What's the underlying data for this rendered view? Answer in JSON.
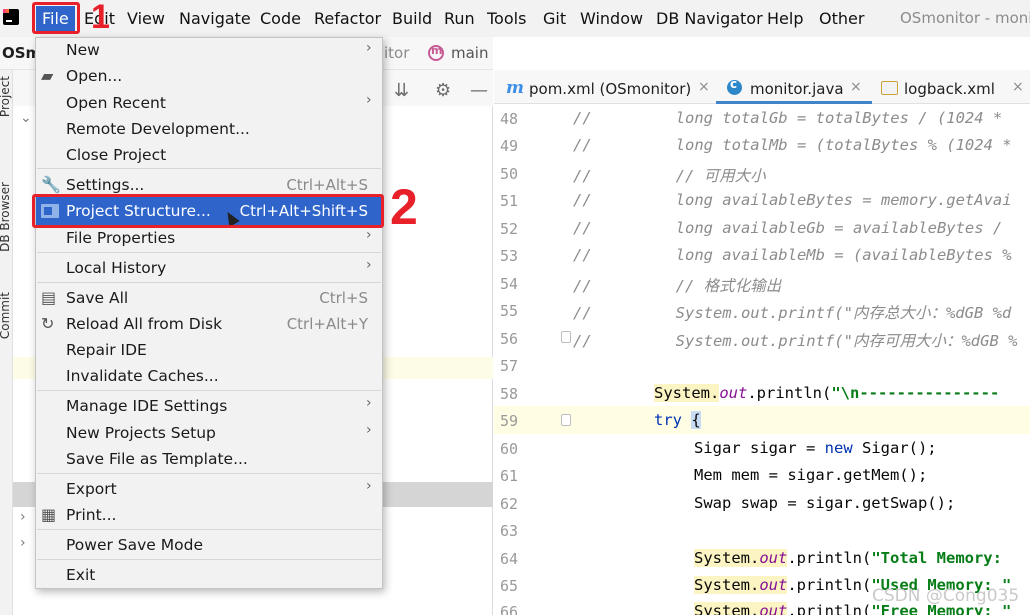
{
  "menubar": {
    "items": [
      "File",
      "Edit",
      "View",
      "Navigate",
      "Code",
      "Refactor",
      "Build",
      "Run",
      "Tools",
      "Git",
      "Window",
      "DB Navigator",
      "Help",
      "Other"
    ],
    "window_title": "OSmonitor - moni"
  },
  "annotations": {
    "step1": "1",
    "step2": "2",
    "color": "#e8202a"
  },
  "navbar": {
    "project_name": "OSm",
    "crumb_rest": "itor",
    "branch": "main"
  },
  "tool_strip": {
    "tabs": [
      "Project",
      "DB Browser",
      "Commit"
    ]
  },
  "editor_tabs": [
    {
      "label": "pom.xml (OSmonitor)",
      "icon": "maven-icon",
      "close": "×"
    },
    {
      "label": "monitor.java",
      "icon": "java-class-icon",
      "close": "×",
      "active": true
    },
    {
      "label": "logback.xml",
      "icon": "xml-file-icon",
      "close": "×"
    }
  ],
  "file_menu": {
    "items": {
      "new": "New",
      "open": "Open...",
      "open_recent": "Open Recent",
      "remote_dev": "Remote Development...",
      "close_project": "Close Project",
      "settings": "Settings...",
      "settings_sc": "Ctrl+Alt+S",
      "project_structure": "Project Structure...",
      "project_structure_sc": "Ctrl+Alt+Shift+S",
      "file_properties": "File Properties",
      "local_history": "Local History",
      "save_all": "Save All",
      "save_all_sc": "Ctrl+S",
      "reload": "Reload All from Disk",
      "reload_sc": "Ctrl+Alt+Y",
      "repair": "Repair IDE",
      "invalidate": "Invalidate Caches...",
      "manage_settings": "Manage IDE Settings",
      "new_projects_setup": "New Projects Setup",
      "save_template": "Save File as Template...",
      "export": "Export",
      "print": "Print...",
      "power_save": "Power Save Mode",
      "exit": "Exit"
    }
  },
  "code": {
    "line_numbers": [
      "48",
      "49",
      "50",
      "51",
      "52",
      "53",
      "54",
      "55",
      "56",
      "57",
      "58",
      "59",
      "60",
      "61",
      "62",
      "63",
      "64",
      "65",
      "66"
    ],
    "l48": "//         long totalGb = totalBytes / (1024 *",
    "l49": "//         long totalMb = (totalBytes % (1024 *",
    "l50": "//         // 可用大小",
    "l51": "//         long availableBytes = memory.getAvai",
    "l52": "//         long availableGb = availableBytes /",
    "l53": "//         long availableMb = (availableBytes %",
    "l54": "//         // 格式化输出",
    "l55": "//         System.out.printf(\"内存总大小：%dGB %d",
    "l56": "//         System.out.printf(\"内存可用大小：%dGB %",
    "l58_a": "System.",
    "l58_b": "out",
    "l58_c": ".println(",
    "l58_d": "\"\\n---------------",
    "l59_a": "try",
    "l59_b": "{",
    "l60_a": "Sigar sigar = ",
    "l60_b": "new",
    "l60_c": " Sigar();",
    "l61": "Mem mem = sigar.getMem();",
    "l62": "Swap swap = sigar.getSwap();",
    "l64_a": "System.",
    "l64_b": "out",
    "l64_c": ".println(",
    "l64_d": "\"Total Memory: ",
    "l65_a": "System.",
    "l65_b": "out",
    "l65_c": ".println(",
    "l65_d": "\"Used Memory: \"",
    "l66_a": "System.",
    "l66_b": "out",
    "l66_c": ".println(",
    "l66_d": "\"Free Memory: \""
  },
  "watermark": "CSDN @Cong035"
}
